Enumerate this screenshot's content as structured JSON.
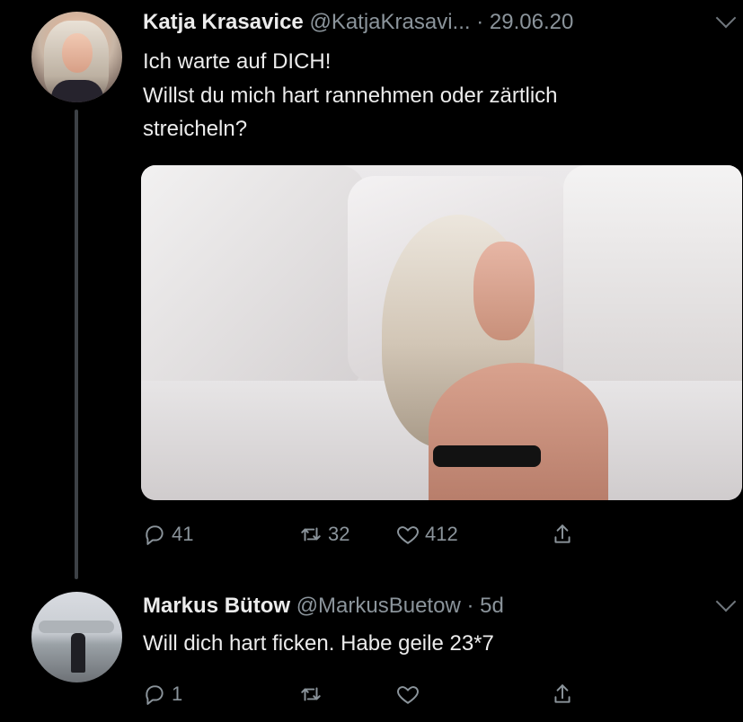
{
  "tweets": [
    {
      "author_name": "Katja Krasavice",
      "author_handle": "@KatjaKrasavi...",
      "separator": "·",
      "date": "29.06.20",
      "text_lines": [
        "Ich warte auf DICH!",
        "Willst du mich hart rannehmen oder zärtlich",
        "streicheln?"
      ],
      "actions": {
        "reply_count": "41",
        "retweet_count": "32",
        "like_count": "412"
      }
    },
    {
      "author_name": "Markus Bütow",
      "author_handle": "@MarkusBuetow",
      "separator": "·",
      "date": "5d",
      "text_lines": [
        "Will dich hart ficken. Habe geile 23*7"
      ],
      "actions": {
        "reply_count": "1",
        "retweet_count": "",
        "like_count": ""
      }
    }
  ],
  "theme": {
    "background": "#000000",
    "text": "#ececec",
    "secondary_text": "#8b949b",
    "thread_line": "#3d4146"
  },
  "icons": {
    "reply": "reply-icon",
    "retweet": "retweet-icon",
    "like": "heart-icon",
    "share": "share-icon",
    "more": "chevron-down-icon"
  }
}
